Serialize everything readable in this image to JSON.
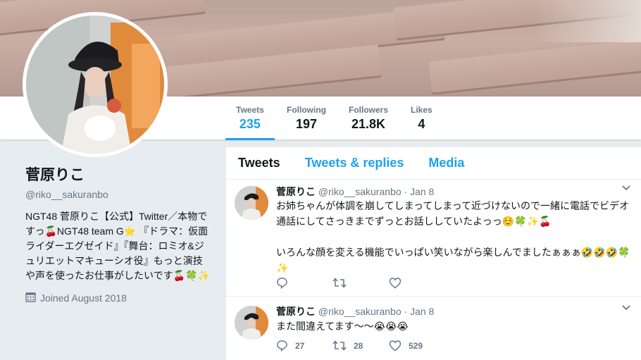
{
  "colors": {
    "accent": "#1da1f2",
    "text": "#14171a",
    "muted": "#657786",
    "background": "#e6ecf0"
  },
  "nav": {
    "stats": [
      {
        "label": "Tweets",
        "value": "235",
        "active": true
      },
      {
        "label": "Following",
        "value": "197"
      },
      {
        "label": "Followers",
        "value": "21.8K"
      },
      {
        "label": "Likes",
        "value": "4"
      }
    ]
  },
  "profile": {
    "name": "菅原りこ",
    "handle": "@riko__sakuranbo",
    "bio": "NGT48 菅原りこ【公式】Twitter／本物ですっ🍒NGT48 team G⭐ 『ドラマ：仮面ライダーエグゼイド』『舞台：ロミオ&ジュリエットマキューシオ役』もっと演技や声を使ったお仕事がしたいです🍒🍀✨",
    "joined": "Joined August 2018",
    "joined_icon": "calendar-icon"
  },
  "timeline": {
    "tabs": [
      "Tweets",
      "Tweets & replies",
      "Media"
    ],
    "tweets": [
      {
        "name": "菅原りこ",
        "handle": "@riko__sakuranbo",
        "date": "· Jan 8",
        "text": "お姉ちゃんが体調を崩してしまってしまって近づけないので一緒に電話でビデオ通話にしてさっきまでずっとお話ししていたよっっ☺️🍀✨🍒\n\nいろんな顔を変える機能でいっぱい笑いながら楽しんでましたぁぁぁ🤣🤣🤣🍀✨",
        "replies": "",
        "retweets": "",
        "likes": ""
      },
      {
        "name": "菅原りこ",
        "handle": "@riko__sakuranbo",
        "date": "· Jan 8",
        "text": "また間違えてます〜〜😭😭😭",
        "replies": "27",
        "retweets": "28",
        "likes": "529"
      }
    ]
  }
}
